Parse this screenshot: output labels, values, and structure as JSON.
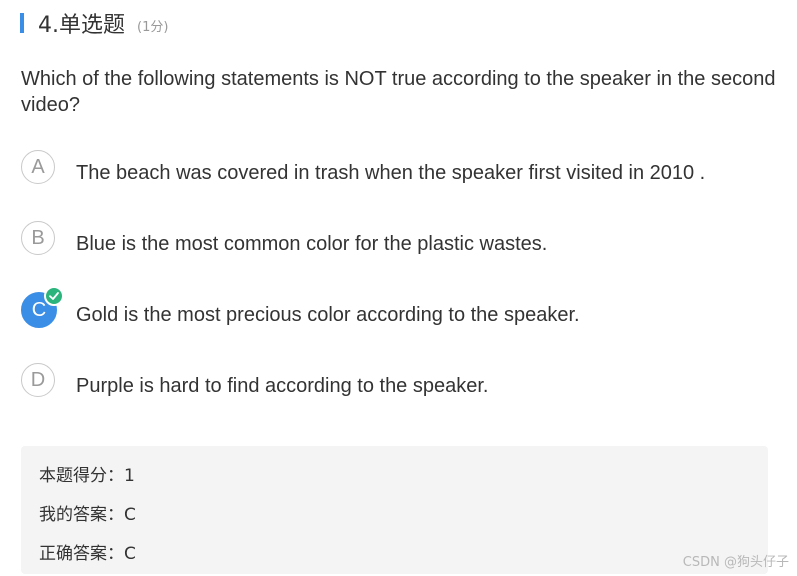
{
  "header": {
    "title": "4.单选题",
    "score": "(1分)",
    "accent_color": "#3a8ee6"
  },
  "question": {
    "text": "Which of the following statements is NOT true according to the speaker in the second video?"
  },
  "options": [
    {
      "letter": "A",
      "text": "The beach was covered in trash when the speaker first visited in 2010 .",
      "selected": false
    },
    {
      "letter": "B",
      "text": "Blue is the most common color for the plastic wastes.",
      "selected": false
    },
    {
      "letter": "C",
      "text": "Gold is the most precious color according to the speaker.",
      "selected": true,
      "correct_icon": "check-icon",
      "selected_color": "#3a8ee6",
      "correct_color": "#2bb57d"
    },
    {
      "letter": "D",
      "text": "Purple is hard to find according to the speaker.",
      "selected": false
    }
  ],
  "result": {
    "score_label": "本题得分：",
    "score_value": "1",
    "my_answer_label": "我的答案：",
    "my_answer_value": "C",
    "correct_answer_label": "正确答案：",
    "correct_answer_value": "C"
  },
  "watermark": "CSDN @狗头仔子"
}
